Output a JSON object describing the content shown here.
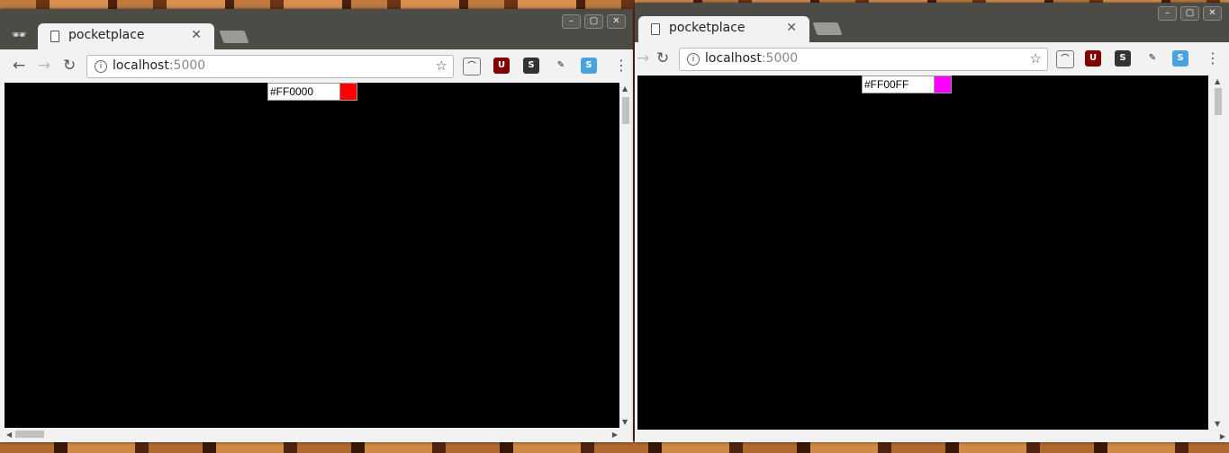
{
  "windows": [
    {
      "tab_title": "pocketplace",
      "url_host": "localhost",
      "url_port": ":5000",
      "color_value": "#FF0000",
      "swatch_color": "#FF0000"
    },
    {
      "tab_title": "pocketplace",
      "url_host": "localhost",
      "url_port": ":5000",
      "color_value": "#FF00FF",
      "swatch_color": "#FF00FF"
    }
  ],
  "icons": {
    "incognito": "incognito-icon",
    "back": "back-arrow-icon",
    "forward": "forward-arrow-icon",
    "reload": "reload-icon",
    "info": "info-icon",
    "bookmark": "star-icon",
    "cast": "cast-icon",
    "ublock": "ublock-icon",
    "stylus": "stylus-icon",
    "eyedropper": "eyedropper-icon",
    "extension": "extension-s-icon",
    "menu": "kebab-menu-icon"
  },
  "colors": {
    "titlebar": "#4d4b46",
    "canvas": "#000000"
  }
}
